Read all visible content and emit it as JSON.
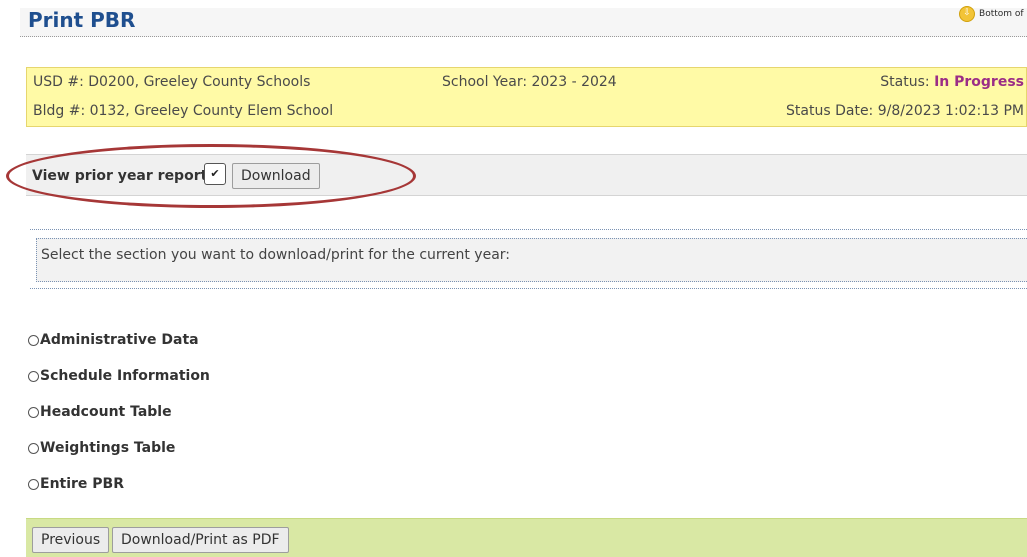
{
  "header": {
    "title": "Print PBR",
    "bottom_link": "Bottom of Pa"
  },
  "info": {
    "usd": "USD #: D0200, Greeley County Schools",
    "school_year": "School Year: 2023 - 2024",
    "status_label": "Status: ",
    "status_value": "In Progress",
    "bldg": "Bldg #: 0132, Greeley County Elem School",
    "status_date": "Status Date: 9/8/2023 1:02:13 PM"
  },
  "prior_year": {
    "label": "View prior year report:",
    "select_value": "",
    "download_label": "Download"
  },
  "section_prompt": "Select the section you want to download/print for the current year:",
  "sections": [
    {
      "label": "Administrative Data"
    },
    {
      "label": "Schedule Information"
    },
    {
      "label": "Headcount Table"
    },
    {
      "label": "Weightings Table"
    },
    {
      "label": "Entire PBR"
    }
  ],
  "footer": {
    "previous_label": "Previous",
    "pdf_label": "Download/Print as PDF"
  },
  "colors": {
    "title": "#1f4f8f",
    "info_bg": "#fffaa6",
    "status_value": "#9b2d86",
    "annotation_oval": "#a63737",
    "footer_bg": "#d9e8a4"
  },
  "icons": {
    "bottom_link": "down-arrow-circle-icon",
    "select": "chevron-down-icon",
    "radio": "radio-unchecked-icon"
  }
}
